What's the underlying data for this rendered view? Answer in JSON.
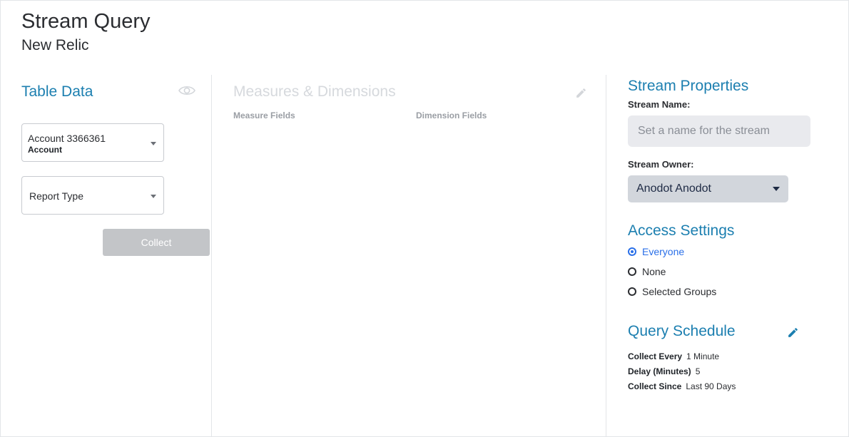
{
  "header": {
    "title": "Stream Query",
    "subtitle": "New Relic"
  },
  "table_data": {
    "heading": "Table Data",
    "account": {
      "value": "Account 3366361",
      "label": "Account"
    },
    "report_type": {
      "value": "Report Type"
    },
    "collect_label": "Collect"
  },
  "measures": {
    "heading": "Measures & Dimensions",
    "measure_fields_label": "Measure Fields",
    "dimension_fields_label": "Dimension Fields"
  },
  "properties": {
    "heading": "Stream Properties",
    "stream_name_label": "Stream Name:",
    "stream_name_placeholder": "Set a name for the stream",
    "stream_owner_label": "Stream Owner:",
    "stream_owner_value": "Anodot Anodot"
  },
  "access": {
    "heading": "Access Settings",
    "options": [
      {
        "label": "Everyone",
        "selected": true
      },
      {
        "label": "None",
        "selected": false
      },
      {
        "label": "Selected Groups",
        "selected": false
      }
    ]
  },
  "schedule": {
    "heading": "Query Schedule",
    "rows": [
      {
        "label": "Collect Every",
        "value": "1 Minute"
      },
      {
        "label": "Delay (Minutes)",
        "value": "5"
      },
      {
        "label": "Collect Since",
        "value": "Last 90 Days"
      }
    ]
  },
  "colors": {
    "accent": "#1c7fb0",
    "radio_selected": "#2a6fe8",
    "disabled_button": "#c3c5c8"
  },
  "icons": {
    "visibility": "eye-icon",
    "edit": "pencil-icon",
    "dropdown": "caret-down-icon"
  }
}
